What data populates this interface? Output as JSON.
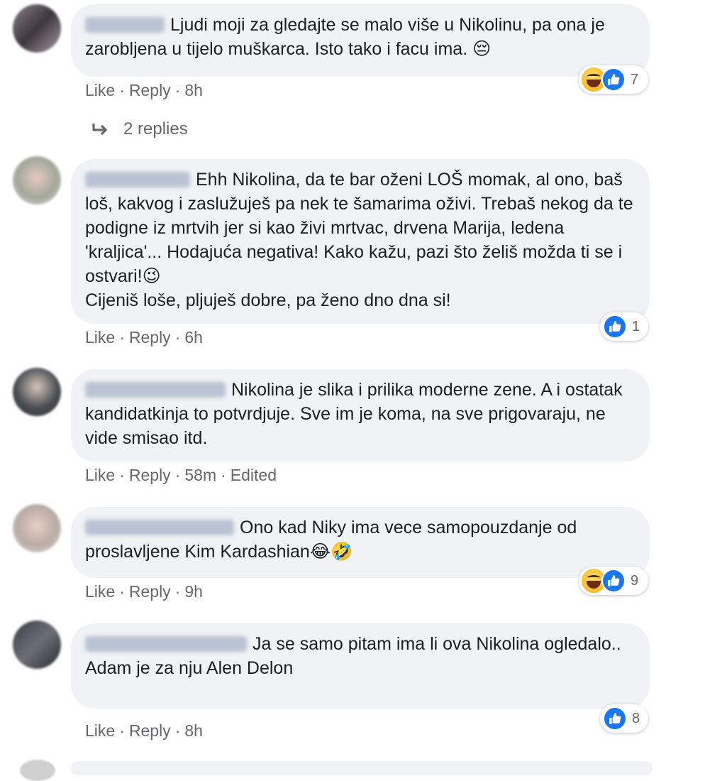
{
  "comments": [
    {
      "text": "Ljudi moji za gledajte se malo više u Nikolinu, pa ona je zarobljena u tijelo muškarca. Isto tako i facu ima. 😔",
      "like_label": "Like",
      "reply_label": "Reply",
      "time": "8h",
      "reaction_count": "7",
      "reactions": [
        "haha-icon",
        "like-icon"
      ]
    },
    {
      "text": "Ehh Nikolina, da te bar oženi LOŠ momak, al ono, baš loš, kakvog i zaslužuješ pa nek te šamarima oživi. Trebaš nekog da te podigne iz mrtvih jer si kao živi mrtvac, drvena Marija, ledena 'kraljica'... Hodajuća negativa! Kako kažu, pazi što želiš možda ti se i ostvari!😉",
      "text2": "Cijeniš loše, pljuješ dobre, pa ženo dno dna si!",
      "like_label": "Like",
      "reply_label": "Reply",
      "time": "6h",
      "reaction_count": "1",
      "reactions": [
        "like-icon"
      ]
    },
    {
      "text": "Nikolina je slika i prilika moderne zene. A i ostatak kandidatkinja to potvrdjuje. Sve im je koma, na sve prigovaraju, ne vide smisao itd.",
      "like_label": "Like",
      "reply_label": "Reply",
      "time": "58m",
      "edited": "Edited"
    },
    {
      "text": "Ono kad Niky ima vece samopouzdanje od proslavljene Kim Kardashian😂🤣",
      "like_label": "Like",
      "reply_label": "Reply",
      "time": "9h",
      "reaction_count": "9",
      "reactions": [
        "haha-icon",
        "like-icon"
      ]
    },
    {
      "text": "Ja se samo pitam ima li ova Nikolina ogledalo..",
      "text2": "Adam je za nju Alen Delon",
      "like_label": "Like",
      "reply_label": "Reply",
      "time": "8h",
      "reaction_count": "8",
      "reactions": [
        "like-icon"
      ]
    }
  ],
  "replies_label": "2 replies",
  "colors": {
    "bubble": "#f0f2f5",
    "meta_text": "#65676b",
    "like_blue": "#1877f2",
    "haha_yellow": "#f7b928"
  }
}
